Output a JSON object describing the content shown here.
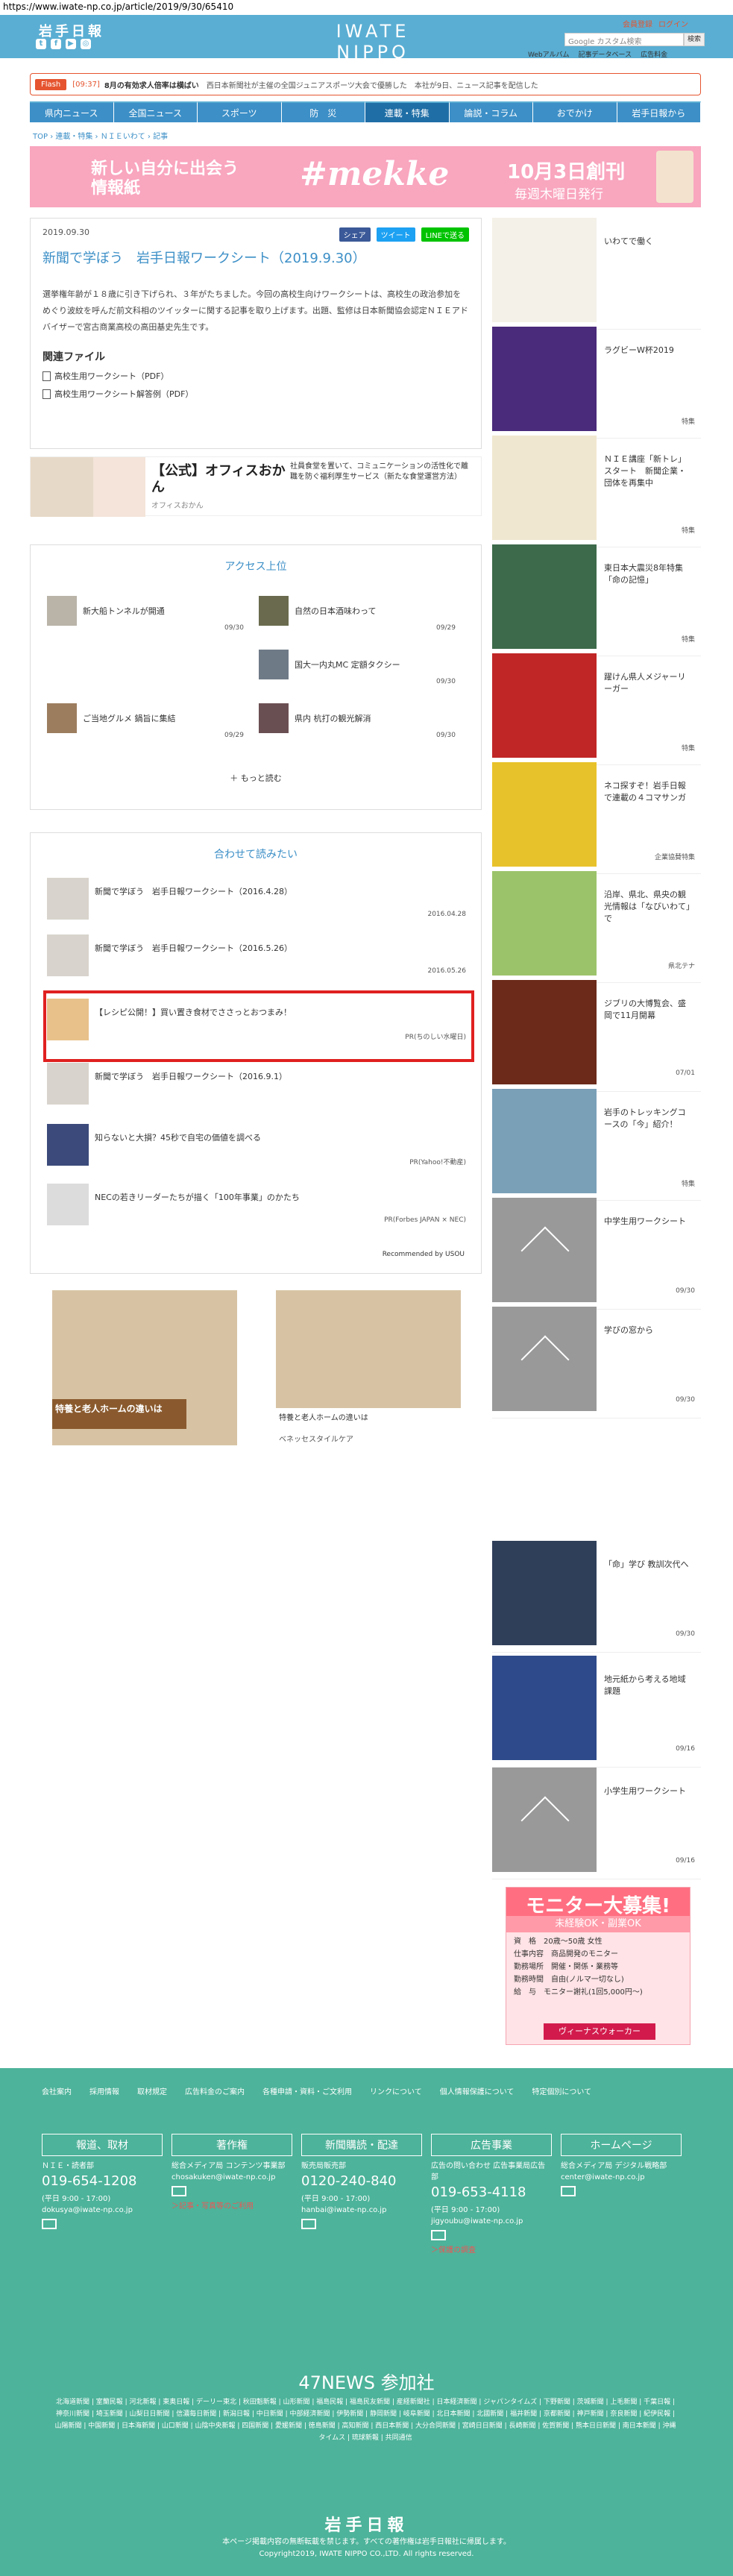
{
  "url": "https://www.iwate-np.co.jp/article/2019/9/30/65410",
  "header": {
    "small_logo": "岩手日報",
    "brand": "IWATE NIPPO",
    "date": "2019.10.01 火",
    "login": [
      "会員登録",
      "ログイン"
    ],
    "search_placeholder": "Google カスタム検索",
    "search_button": "検索",
    "links": [
      "Webアルバム",
      "記事データベース",
      "広告料金"
    ]
  },
  "flash": {
    "tag": "Flash",
    "time": "[09:37]",
    "headline": "8月の有効求人倍率は横ばい",
    "text": "西日本新聞社が主催の全国ジュニアスポーツ大会で優勝した　本社が9日、ニュース記事を配信した"
  },
  "nav": {
    "items": [
      "県内ニュース",
      "全国ニュース",
      "スポーツ",
      "防　災",
      "連載・特集",
      "論説・コラム",
      "おでかけ",
      "岩手日報から"
    ],
    "active": 4
  },
  "breadcrumb": "TOP › 連載・特集 › ＮＩＥいわて › 記事",
  "top_ad": {
    "line1": "新しい自分に出会う",
    "line2": "情報紙",
    "brand": "#mekke",
    "launch": "10月3日創刊",
    "weekly": "毎週木曜日発行"
  },
  "article": {
    "date": "2019.09.30",
    "share": [
      "シェア",
      "ツイート",
      "LINEで送る"
    ],
    "title": "新聞で学ぼう　岩手日報ワークシート（2019.9.30）",
    "body": "選挙権年齢が１８歳に引き下げられ、３年がたちました。今回の高校生向けワークシートは、高校生の政治参加をめぐり波紋を呼んだ前文科相のツイッターに関する記事を取り上げます。出題、監修は日本新聞協会認定ＮＩＥアドバイザーで宮古商業高校の高田基史先生です。",
    "files_heading": "関連ファイル",
    "files": [
      "高校生用ワークシート（PDF）",
      "高校生用ワークシート解答例（PDF）"
    ]
  },
  "ad_strip": {
    "title": "【公式】オフィスおかん",
    "source": "オフィスおかん",
    "desc": "社員食堂を置いて、コミュニケーションの活性化で離職を防ぐ福利厚生サービス（新たな食堂運営方法）"
  },
  "access": {
    "heading": "アクセス上位",
    "items": [
      {
        "title": "新大船トンネルが開通",
        "date": "09/30"
      },
      {
        "title": "自然の日本酒味わって",
        "date": "09/29"
      },
      {
        "title": "国大一内丸MC 定額タクシー",
        "date": "09/30"
      },
      {
        "title": "ご当地グルメ 鍋旨に集結",
        "date": "09/29"
      },
      {
        "title": "県内 杭打の観光解消",
        "date": "09/30"
      }
    ],
    "more": "＋ もっと読む"
  },
  "recommend": {
    "heading": "合わせて読みたい",
    "items": [
      {
        "title": "新聞で学ぼう　岩手日報ワークシート（2016.4.28）",
        "src": "2016.04.28"
      },
      {
        "title": "新聞で学ぼう　岩手日報ワークシート（2016.5.26）",
        "src": "2016.05.26"
      },
      {
        "title": "【レシピ公開！】買い置き食材でささっとおつまみ！",
        "src": "PR(ちのしい水曜日)"
      },
      {
        "title": "新聞で学ぼう　岩手日報ワークシート（2016.9.1）",
        "src": ""
      },
      {
        "title": "知らないと大損？45秒で自宅の価値を調べる",
        "src": "PR(Yahoo!不動産)"
      },
      {
        "title": "NECの若きリーダーたちが描く「100年事業」のかたち",
        "src": "PR(Forbes JAPAN × NEC)"
      }
    ],
    "powered": "Recommended by USOU"
  },
  "ad_bottom": {
    "left_caption": "特養と老人ホームの違いは",
    "right_caption": "特養と老人ホームの違いは",
    "right_src": "ベネッセスタイルケア"
  },
  "sidebar": [
    {
      "title": "いわてで働く",
      "date": ""
    },
    {
      "title": "ラグビーW杯2019",
      "date": "特集"
    },
    {
      "title": "ＮＩＥ講座「新トレ」スタート　新聞企業・団体を再集中",
      "date": "特集"
    },
    {
      "title": "東日本大震災8年特集「命の記憶」",
      "date": "特集"
    },
    {
      "title": "躍けん県人メジャーリーガー",
      "date": "特集"
    },
    {
      "title": "ネコ探すぞ！岩手日報で連載の４コマサンガ",
      "date": "企業協賛特集"
    },
    {
      "title": "沿岸、県北、県央の観光情報は「なびいわて」で",
      "date": "県北テナ"
    },
    {
      "title": "ジブリの大博覧会、盛岡で11月開幕",
      "date": "07/01"
    },
    {
      "title": "岩手のトレッキングコースの「今」紹介！",
      "date": "特集"
    },
    {
      "title": "中学生用ワークシート",
      "date": "09/30"
    },
    {
      "title": "学びの窓から",
      "date": "09/30"
    },
    {
      "title": "「命」学び 教訓次代へ",
      "date": "09/30"
    },
    {
      "title": "地元紙から考える地域課題",
      "date": "09/16"
    },
    {
      "title": "小学生用ワークシート",
      "date": "09/16"
    }
  ],
  "monitor_ad": {
    "title": "モニター大募集!",
    "sub": "未経験OK・副業OK",
    "rows": [
      "資　格　20歳〜50歳 女性",
      "仕事内容　商品開発のモニター",
      "勤務場所　開催・関係・業務等",
      "勤務時間　自由(ノルマ一切なし)",
      "給　与　モニター謝礼(1回5,000円〜)"
    ],
    "brand": "ヴィーナスウォーカー"
  },
  "footer": {
    "links": [
      "会社案内",
      "採用情報",
      "取材規定",
      "広告料金のご案内",
      "各種申請・資料・ご文利用",
      "リンクについて",
      "個人情報保護について",
      "特定個別について"
    ],
    "boxes": [
      {
        "h": "報道、取材",
        "s": "ＮＩＥ・読者部",
        "tel": "019-654-1208",
        "hours": "(平日 9:00 - 17:00)",
        "mail": "dokusya@iwate-np.co.jp",
        "note": ""
      },
      {
        "h": "著作権",
        "s": "総合メディア局\nコンテンツ事業部",
        "tel": "",
        "hours": "",
        "mail": "chosakuken@iwate-np.co.jp",
        "note": "＞記事・写真等のご利用"
      },
      {
        "h": "新聞購読・配達",
        "s": "販売局販売部",
        "tel": "0120-240-840",
        "hours": "(平日 9:00 - 17:00)",
        "mail": "hanbai@iwate-np.co.jp",
        "note": ""
      },
      {
        "h": "広告事業",
        "s": "広告の問い合わせ\n広告事業局広告部",
        "tel": "019-653-4118",
        "hours": "(平日 9:00 - 17:00)",
        "mail": "jigyoubu@iwate-np.co.jp",
        "note": "＞保護の調査"
      },
      {
        "h": "ホームページ",
        "s": "総合メディア局\nデジタル戦略部",
        "tel": "",
        "hours": "",
        "mail": "center@iwate-np.co.jp",
        "note": ""
      }
    ],
    "news47_title": "47NEWS 参加社",
    "news47_list": "北海道新聞 | 室蘭民報 | 河北新報 | 東奥日報 | デーリー東北 | 秋田魁新報 | 山形新聞 | 福島民報 | 福島民友新聞 | 産経新聞社 | 日本経済新聞 | ジャパンタイムズ | 下野新聞 | 茨城新聞 | 上毛新聞 | 千葉日報 | 神奈川新聞 | 埼玉新聞 | 山梨日日新聞 | 信濃毎日新聞 | 新潟日報 | 中日新聞 | 中部経済新聞 | 伊勢新聞 | 静岡新聞 | 岐阜新聞 | 北日本新聞 | 北國新聞 | 福井新聞 | 京都新聞 | 神戸新聞 | 奈良新聞 | 紀伊民報 | 山陽新聞 | 中国新聞 | 日本海新聞 | 山口新聞 | 山陰中央新報 | 四国新聞 | 愛媛新聞 | 徳島新聞 | 高知新聞 | 西日本新聞 | 大分合同新聞 | 宮崎日日新聞 | 長崎新聞 | 佐賀新聞 | 熊本日日新聞 | 南日本新聞 | 沖縄タイムス | 琉球新報 | 共同通信",
    "logo": "岩手日報",
    "notice": "本ページ掲載内容の無断転載を禁じます。すべての著作権は岩手日報社に帰属します。",
    "copyright": "Copyright2019, IWATE NIPPO CO.,LTD. All rights reserved."
  }
}
